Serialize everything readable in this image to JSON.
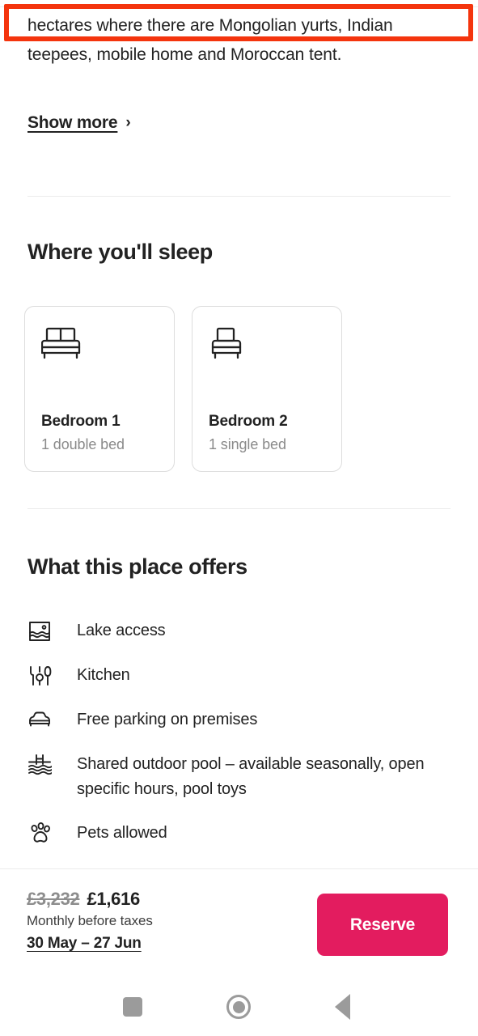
{
  "description": {
    "text": "hectares where there are Mongolian yurts, Indian teepees, mobile home and Moroccan tent.",
    "show_more_label": "Show more",
    "chevron": "›"
  },
  "annotation": {
    "color": "#f4340d"
  },
  "sleep_section": {
    "title": "Where you'll sleep",
    "rooms": [
      {
        "name": "Bedroom 1",
        "beds": "1 double bed",
        "icon": "double-bed-icon"
      },
      {
        "name": "Bedroom 2",
        "beds": "1 single bed",
        "icon": "single-bed-icon"
      }
    ]
  },
  "offers_section": {
    "title": "What this place offers",
    "amenities": [
      {
        "label": "Lake access",
        "icon": "lake-icon"
      },
      {
        "label": "Kitchen",
        "icon": "kitchen-utensils-icon"
      },
      {
        "label": "Free parking on premises",
        "icon": "car-icon"
      },
      {
        "label": "Shared outdoor pool – available seasonally, open specific hours, pool toys",
        "icon": "pool-icon"
      },
      {
        "label": "Pets allowed",
        "icon": "paw-icon"
      }
    ]
  },
  "booking_bar": {
    "price_original": "£3,232",
    "price_discounted": "£1,616",
    "price_note": "Monthly before taxes",
    "date_range": "30 May – 27 Jun",
    "reserve_label": "Reserve",
    "accent_color": "#e31c5f"
  },
  "nav_bar": {
    "recents_label": "recents-square-icon",
    "home_label": "home-circle-icon",
    "back_label": "back-triangle-icon"
  }
}
